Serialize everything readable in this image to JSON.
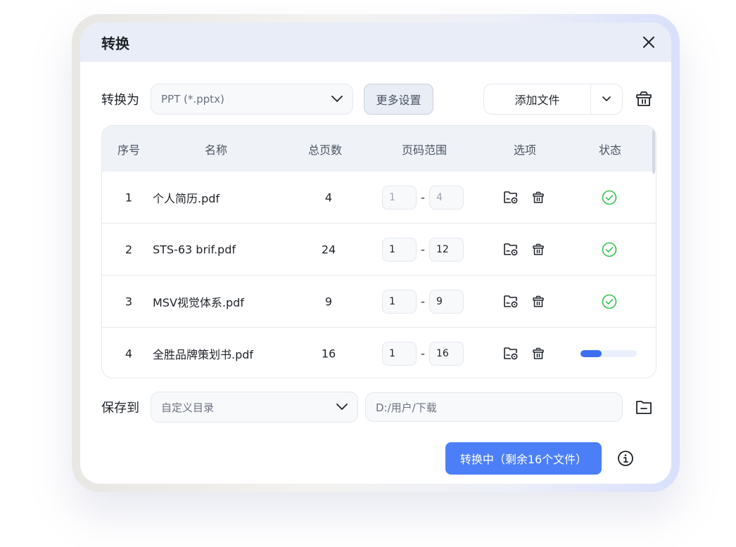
{
  "dialog": {
    "title": "转换",
    "convert_label": "转换为",
    "format_select": {
      "value": "PPT (*.pptx)"
    },
    "more_settings_label": "更多设置",
    "add_file_label": "添加文件",
    "table": {
      "headers": [
        "序号",
        "名称",
        "总页数",
        "页码范围",
        "选项",
        "状态"
      ],
      "rows": [
        {
          "index": "1",
          "name": "个人简历.pdf",
          "pages": "4",
          "from": "1",
          "to": "4",
          "status": "done"
        },
        {
          "index": "2",
          "name": "STS-63 brif.pdf",
          "pages": "24",
          "from": "1",
          "to": "12",
          "status": "done"
        },
        {
          "index": "3",
          "name": "MSV视觉体系.pdf",
          "pages": "9",
          "from": "1",
          "to": "9",
          "status": "done"
        },
        {
          "index": "4",
          "name": "全胜品牌策划书.pdf",
          "pages": "16",
          "from": "1",
          "to": "16",
          "status": "progress",
          "progress": 0.38
        }
      ],
      "range_separator": "-"
    },
    "save_label": "保存到",
    "save_select": {
      "value": "自定义目录"
    },
    "save_path": "D:/用户/下载",
    "convert_button_label": "转换中（剩余16个文件）"
  },
  "colors": {
    "accent": "#4c7ff7",
    "success": "#34c24a",
    "progress": "#3b6ff5",
    "header_bg": "#e8edf7"
  },
  "icons": {
    "close": "close-icon",
    "dropdown": "chevron-down-icon",
    "clear": "trash-basket-icon",
    "row_folder": "folder-settings-icon",
    "row_delete": "trash-icon",
    "status_done": "check-circle-icon",
    "save_folder": "folder-icon",
    "info": "info-icon"
  }
}
